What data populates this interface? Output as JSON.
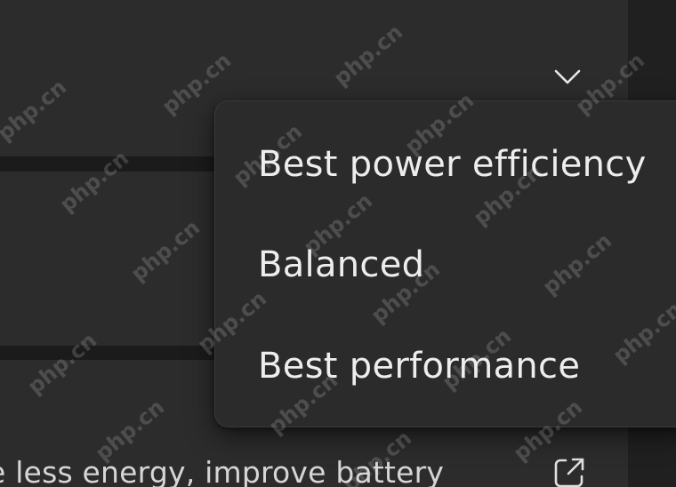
{
  "power_mode": {
    "chevron_icon": "chevron-down-icon",
    "options": [
      {
        "label": "Best power efficiency"
      },
      {
        "label": "Balanced"
      },
      {
        "label": "Best performance"
      }
    ]
  },
  "battery_saver": {
    "description": "e less energy, improve battery",
    "link_icon": "open-external-icon"
  },
  "watermark": {
    "text": "php.cn"
  },
  "colors": {
    "card_background": "#2c2c2c",
    "menu_background": "#2b2b2b",
    "text": "#ededed",
    "page_background": "#1b1b1b"
  }
}
